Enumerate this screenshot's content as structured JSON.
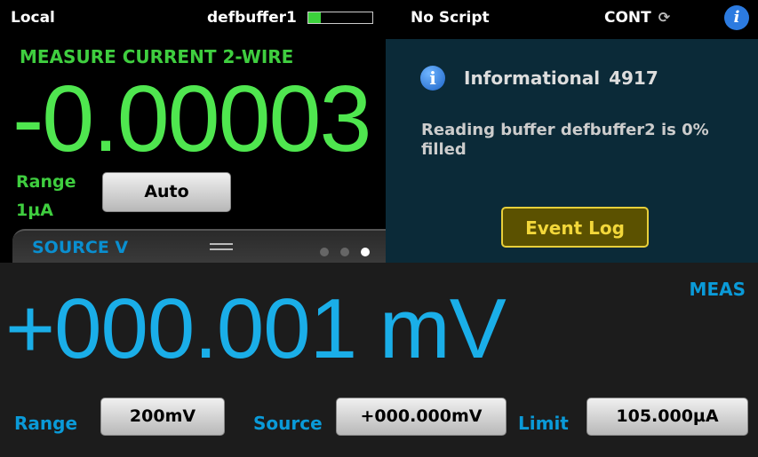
{
  "status_bar": {
    "mode": "Local",
    "buffer_name": "defbuffer1",
    "buffer_fill": 0.2,
    "script": "No Script",
    "trigger_mode": "CONT",
    "refresh_icon": "refresh-icon",
    "info_icon": "info-icon"
  },
  "measure": {
    "function": "MEASURE CURRENT 2-WIRE",
    "reading": "-0.00003",
    "range_label": "Range",
    "range_value": "1µA",
    "range_button": "Auto"
  },
  "source_tab": {
    "label": "SOURCE V",
    "active_page": 3,
    "page_count": 3
  },
  "event_popup": {
    "icon": "info-icon",
    "title": "Informational",
    "code": "4917",
    "message": "Reading buffer defbuffer2 is 0% filled",
    "button": "Event Log"
  },
  "source": {
    "meas_tag": "MEAS",
    "reading": "+000.001 mV",
    "range_label": "Range",
    "range_value": "200mV",
    "source_label": "Source",
    "source_value": "+000.000mV",
    "limit_label": "Limit",
    "limit_value": "105.000µA"
  },
  "colors": {
    "measure_green": "#4fe64f",
    "source_blue": "#1aaee8",
    "popup_bg": "#0b2a38",
    "event_log_yellow": "#f2d73a"
  }
}
